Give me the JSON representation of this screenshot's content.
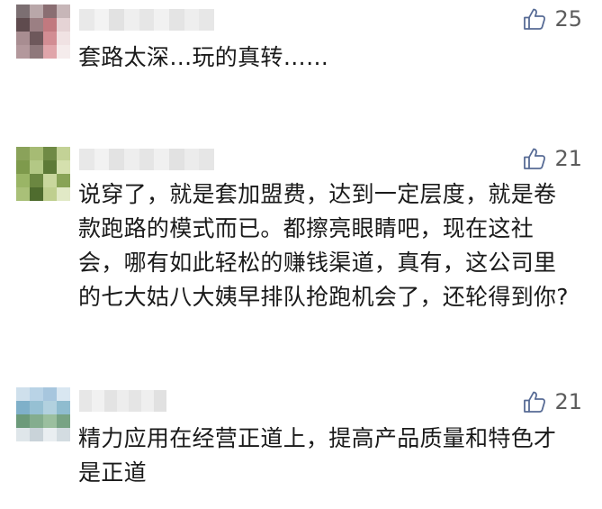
{
  "comments": [
    {
      "likes": "25",
      "text": "套路太深…玩的真转……",
      "avatar_colors": [
        "#7c6f72",
        "#b9a7a9",
        "#8a6e72",
        "#c7b6b8",
        "#5f4b4e",
        "#9b7f83",
        "#c1797f",
        "#e5d3d5",
        "#a88d91",
        "#6e585b",
        "#d28d93",
        "#f0e2e3",
        "#b3989c",
        "#8f787b",
        "#e0a5aa",
        "#f5ecec"
      ],
      "username_colors": [
        "#e9e9e9",
        "#f3f3f3",
        "#e2e2e2",
        "#efefef",
        "#e6e6e6",
        "#f1f1f1",
        "#e4e4e4",
        "#eeeeee",
        "#e7e7e7"
      ]
    },
    {
      "likes": "21",
      "text": "说穿了，就是套加盟费，达到一定层度，就是卷款跑路的模式而已。都擦亮眼睛吧，现在这社会，哪有如此轻松的赚钱渠道，真有，这公司里的七大姑八大姨早排队抢跑机会了，还轮得到你?",
      "avatar_colors": [
        "#8aa25a",
        "#a6bb74",
        "#6f8a45",
        "#c3d296",
        "#7e9a4c",
        "#b3c885",
        "#5d7a37",
        "#d5e0ae",
        "#9ab566",
        "#6b8741",
        "#c9d79d",
        "#88a356",
        "#a9c078",
        "#4f6c2e",
        "#bfcf8f",
        "#e1e9c6"
      ],
      "username_colors": [
        "#e8e8e8",
        "#f2f2f2",
        "#e3e3e3",
        "#eeeeee",
        "#e5e5e5",
        "#f0f0f0",
        "#e2e2e2",
        "#ececec",
        "#e6e6e6"
      ]
    },
    {
      "likes": "21",
      "text": "精力应用在经营正道上，提高产品质量和特色才是正道",
      "avatar_colors": [
        "#cfe0ec",
        "#b9d3e6",
        "#a7c6de",
        "#d9e7f1",
        "#7fb0c9",
        "#96c0d3",
        "#b2d1df",
        "#8fbccf",
        "#6c9a7a",
        "#84ad8e",
        "#9bbf9f",
        "#78a384",
        "#dfe6ea",
        "#c9d3d9",
        "#e9eef1",
        "#d3dce1"
      ],
      "username_colors": [
        "#e7e7e7",
        "#f1f1f1",
        "#e3e3e3",
        "#ededed",
        "#e5e5e5",
        "#efefef",
        "#e1e1e1"
      ]
    }
  ]
}
